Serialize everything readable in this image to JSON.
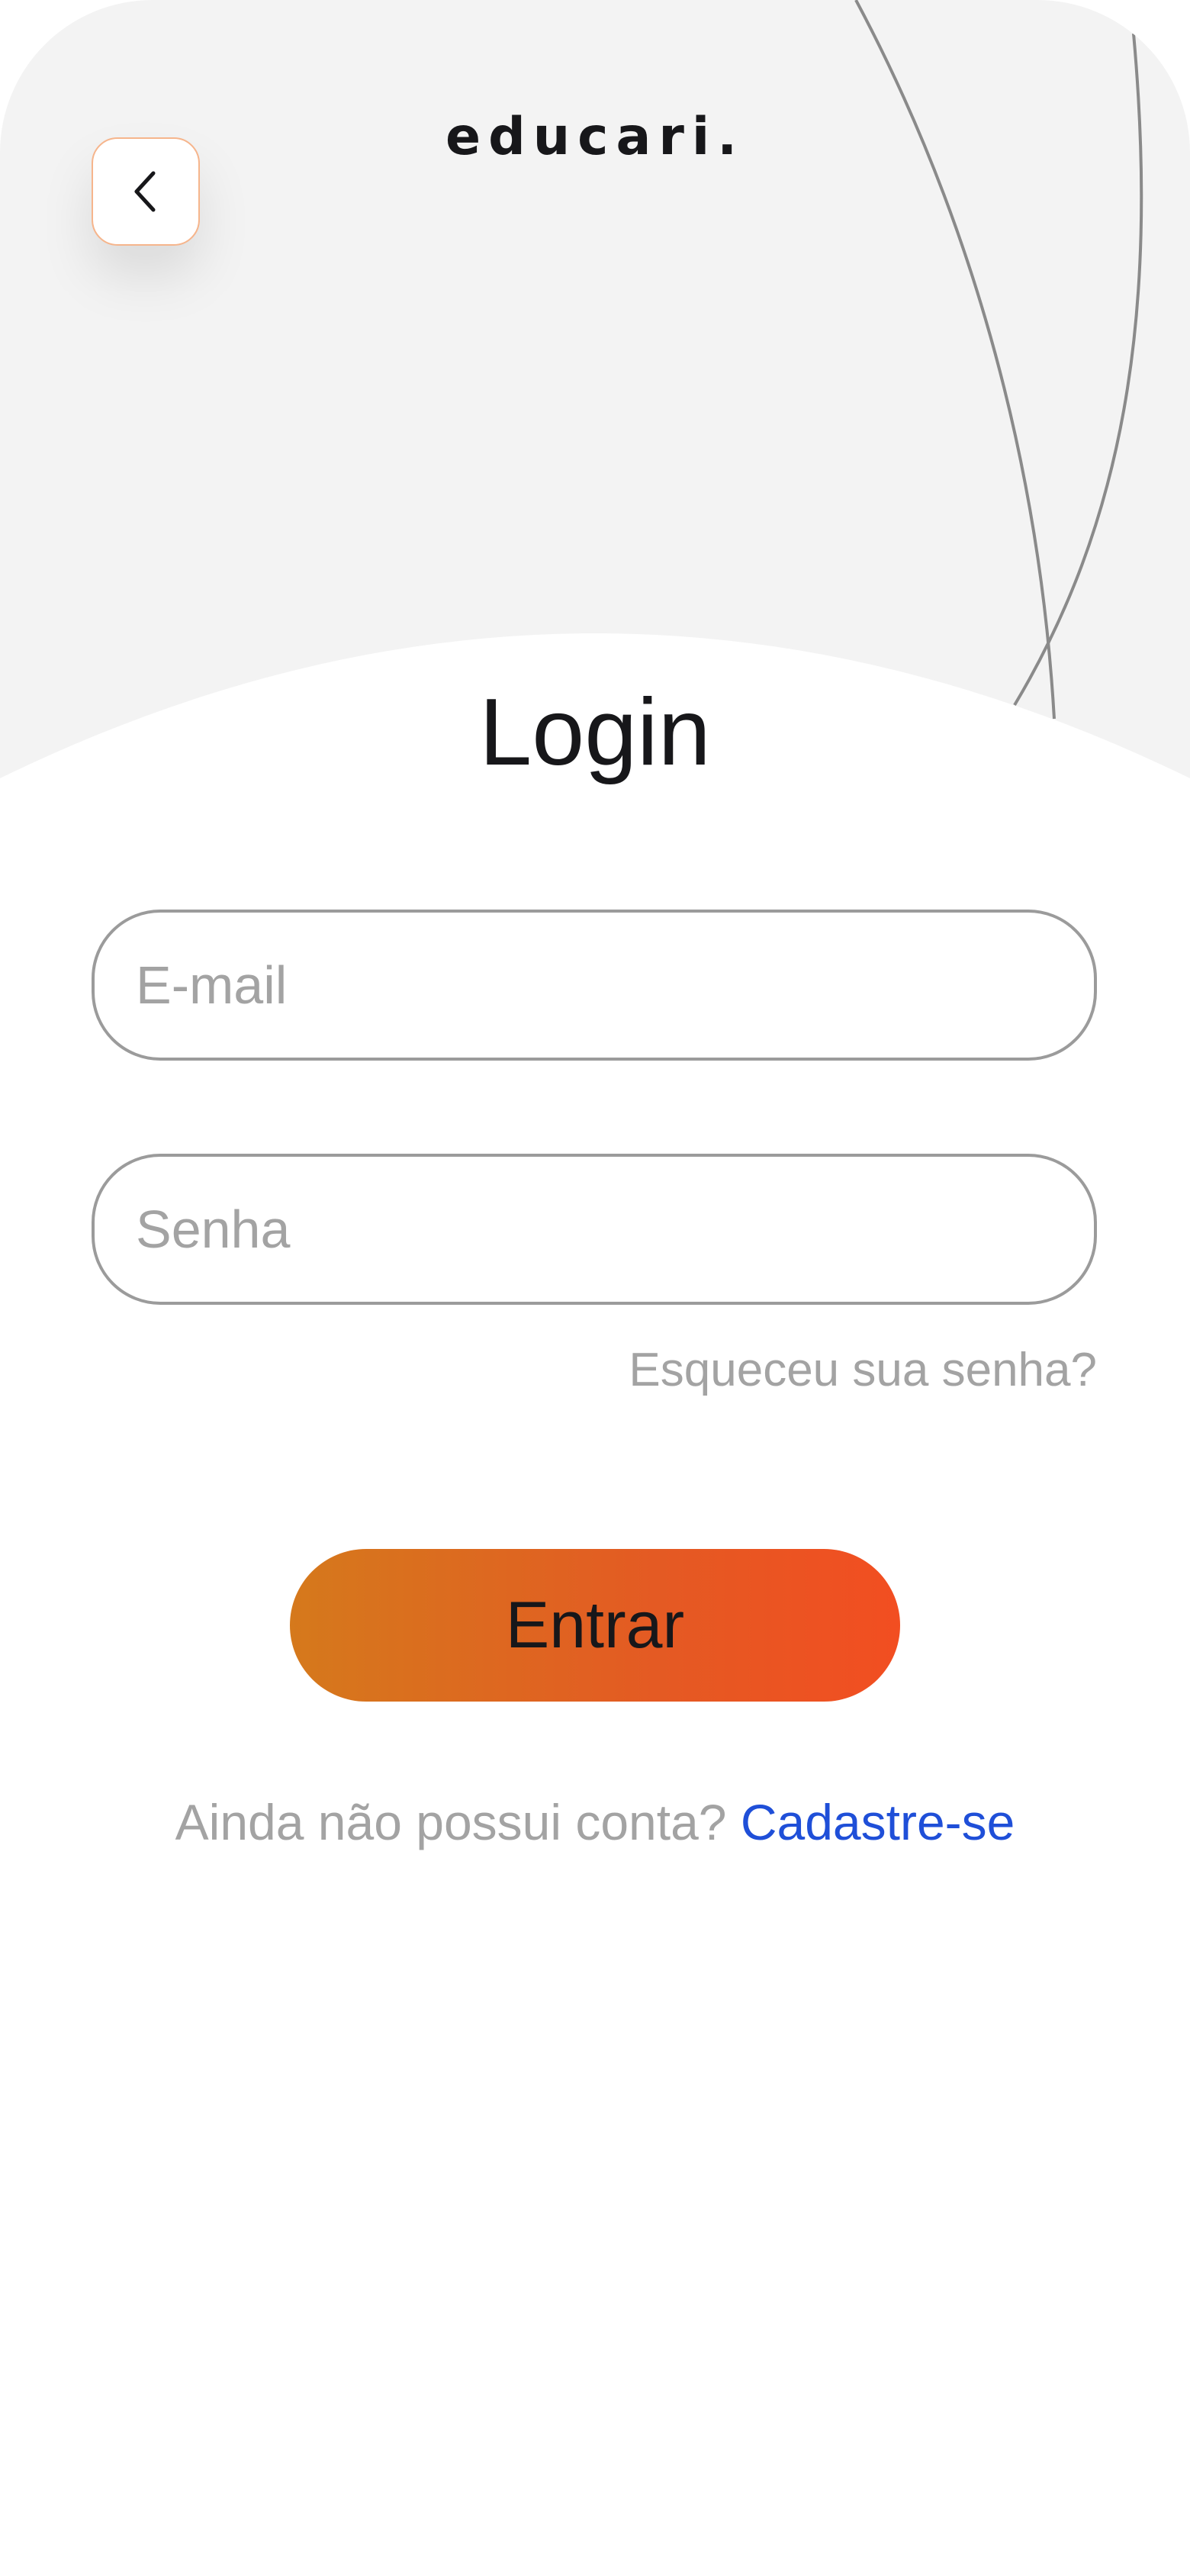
{
  "app": {
    "brand": "educari."
  },
  "header": {
    "back_icon": "chevron-left-icon"
  },
  "login": {
    "title": "Login",
    "email_placeholder": "E-mail",
    "email_value": "",
    "password_placeholder": "Senha",
    "password_value": "",
    "forgot_label": "Esqueceu sua senha?",
    "submit_label": "Entrar",
    "signup_prompt": "Ainda não possui conta?",
    "signup_label": "Cadastre-se"
  },
  "colors": {
    "header_background": "#f3f3f3",
    "button_gradient_start": "#d5791c",
    "button_gradient_end": "#f24e21",
    "link": "#1f4fd8",
    "placeholder": "#a3a3a3",
    "text_dark": "#17171a"
  }
}
